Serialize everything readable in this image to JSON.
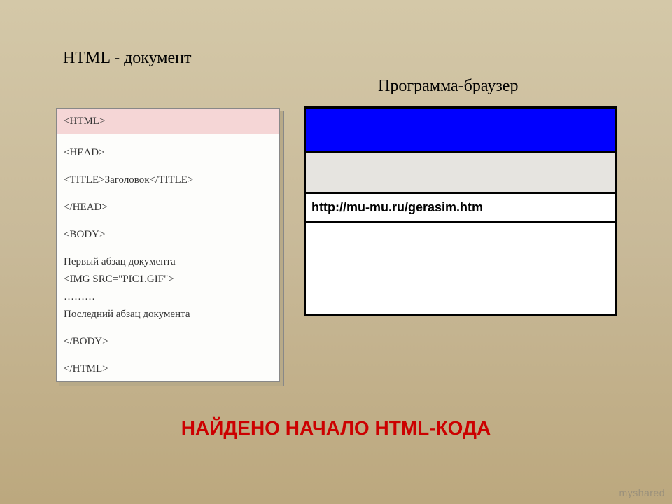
{
  "labels": {
    "left_title": "HTML - документ",
    "right_title": "Программа-браузер"
  },
  "code": {
    "line_html": "<HTML>",
    "line_head": "<HEAD>",
    "line_title": "<TITLE>Заголовок</TITLE>",
    "line_head_close": "</HEAD>",
    "line_body": "<BODY>",
    "line_p1": "Первый абзац документа",
    "line_img": "<IMG SRC=\"PIC1.GIF\">",
    "line_dots": "………",
    "line_p2": "Последний абзац документа",
    "line_body_close": "</BODY>",
    "line_html_close": "</HTML>"
  },
  "browser": {
    "url": "http://mu-mu.ru/gerasim.htm"
  },
  "caption": "НАЙДЕНО НАЧАЛО HTML-КОДА",
  "watermark": "myshared"
}
